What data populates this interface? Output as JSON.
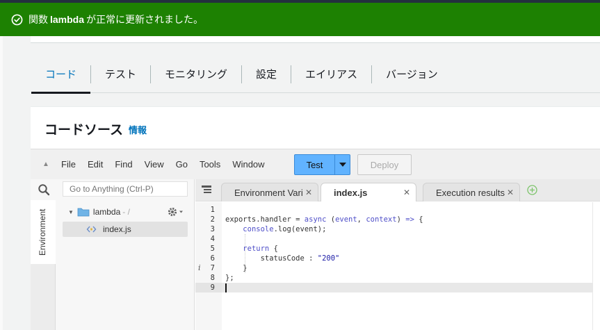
{
  "banner": {
    "prefix": "関数",
    "function_name": "lambda",
    "suffix": "が正常に更新されました。",
    "color": "#1d8102"
  },
  "tabs": [
    {
      "label": "コード",
      "active": true
    },
    {
      "label": "テスト",
      "active": false
    },
    {
      "label": "モニタリング",
      "active": false
    },
    {
      "label": "設定",
      "active": false
    },
    {
      "label": "エイリアス",
      "active": false
    },
    {
      "label": "バージョン",
      "active": false
    }
  ],
  "panel": {
    "title": "コードソース",
    "info_link": "情報"
  },
  "menubar": {
    "items": [
      "File",
      "Edit",
      "Find",
      "View",
      "Go",
      "Tools",
      "Window"
    ],
    "test_label": "Test",
    "deploy_label": "Deploy"
  },
  "sidebar": {
    "search_placeholder": "Go to Anything (Ctrl-P)",
    "vertical_tab": "Environment",
    "tree_root": "lambda",
    "tree_root_path": "- /",
    "tree_file": "index.js"
  },
  "editor_tabs": [
    {
      "label": "Environment Vari",
      "active": false
    },
    {
      "label": "index.js",
      "active": true
    },
    {
      "label": "Execution results",
      "active": false
    }
  ],
  "editor": {
    "line_numbers": [
      "1",
      "2",
      "3",
      "4",
      "5",
      "6",
      "7",
      "8",
      "9"
    ],
    "lines": [
      "",
      "exports.handler = async (event, context) => {",
      "    console.log(event);",
      "",
      "    return {",
      "        statusCode : \"200\"",
      "    }",
      "};",
      ""
    ]
  },
  "colors": {
    "accent": "#0073bb",
    "test_button": "#61b3ff"
  },
  "icons": {
    "banner": "check-circle-icon",
    "search": "search-icon",
    "folder": "folder-icon",
    "settings": "gear-icon",
    "file": "js-file-icon",
    "tab_list": "tab-list-icon",
    "add_tab": "add-tab-icon"
  }
}
